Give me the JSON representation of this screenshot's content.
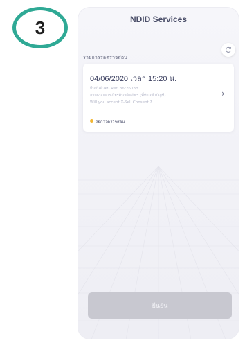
{
  "step": {
    "number": "3"
  },
  "header": {
    "title": "NDID Services"
  },
  "section": {
    "title": "รายการรอตรวจสอบ"
  },
  "request": {
    "datetime": "04/06/2020 เวลา 15:20 น.",
    "ref": "ยืนยันตัวตน Ref: 36f2603b",
    "source": "จากธนาคารเกียรตินาคินภัทร (ที่ท่านทำบัญชี)",
    "question": "Will you accept X-Sell Consent ?",
    "status": "รอการตรวจสอบ"
  },
  "footer": {
    "confirm_label": "ยืนยัน"
  },
  "colors": {
    "accent": "#2fa995",
    "status_pending": "#f2b632",
    "button_disabled": "#c8c8d0"
  },
  "icons": {
    "refresh": "refresh-icon",
    "chevron": "chevron-right-icon"
  }
}
